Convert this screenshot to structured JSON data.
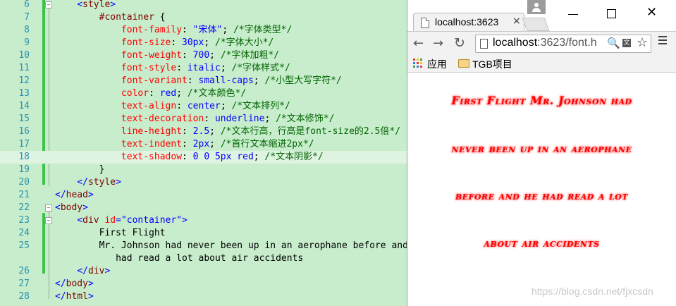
{
  "editor": {
    "lines": [
      {
        "n": "6",
        "indent": "    ",
        "tokens": [
          {
            "c": "t-punc",
            "t": "<"
          },
          {
            "c": "t-tag",
            "t": "style"
          },
          {
            "c": "t-punc",
            "t": ">"
          }
        ]
      },
      {
        "n": "7",
        "indent": "        ",
        "tokens": [
          {
            "c": "t-sel",
            "t": "#container"
          },
          {
            "c": "t-text",
            "t": " {"
          }
        ]
      },
      {
        "n": "8",
        "indent": "            ",
        "tokens": [
          {
            "c": "t-prop",
            "t": "font-family"
          },
          {
            "c": "t-text",
            "t": ": "
          },
          {
            "c": "t-val",
            "t": "\"宋体\""
          },
          {
            "c": "t-text",
            "t": "; "
          },
          {
            "c": "t-cmt",
            "t": "/*字体类型*/"
          }
        ]
      },
      {
        "n": "9",
        "indent": "            ",
        "tokens": [
          {
            "c": "t-prop",
            "t": "font-size"
          },
          {
            "c": "t-text",
            "t": ": "
          },
          {
            "c": "t-val",
            "t": "30px"
          },
          {
            "c": "t-text",
            "t": "; "
          },
          {
            "c": "t-cmt",
            "t": "/*字体大小*/"
          }
        ]
      },
      {
        "n": "10",
        "indent": "            ",
        "tokens": [
          {
            "c": "t-prop",
            "t": "font-weight"
          },
          {
            "c": "t-text",
            "t": ": "
          },
          {
            "c": "t-val",
            "t": "700"
          },
          {
            "c": "t-text",
            "t": "; "
          },
          {
            "c": "t-cmt",
            "t": "/*字体加粗*/"
          }
        ]
      },
      {
        "n": "11",
        "indent": "            ",
        "tokens": [
          {
            "c": "t-prop",
            "t": "font-style"
          },
          {
            "c": "t-text",
            "t": ": "
          },
          {
            "c": "t-val",
            "t": "italic"
          },
          {
            "c": "t-text",
            "t": "; "
          },
          {
            "c": "t-cmt",
            "t": "/*字体样式*/"
          }
        ]
      },
      {
        "n": "12",
        "indent": "            ",
        "tokens": [
          {
            "c": "t-prop",
            "t": "font-variant"
          },
          {
            "c": "t-text",
            "t": ": "
          },
          {
            "c": "t-val",
            "t": "small-caps"
          },
          {
            "c": "t-text",
            "t": "; "
          },
          {
            "c": "t-cmt",
            "t": "/*小型大写字符*/"
          }
        ]
      },
      {
        "n": "13",
        "indent": "            ",
        "tokens": [
          {
            "c": "t-prop",
            "t": "color"
          },
          {
            "c": "t-text",
            "t": ": "
          },
          {
            "c": "t-val",
            "t": "red"
          },
          {
            "c": "t-text",
            "t": "; "
          },
          {
            "c": "t-cmt",
            "t": "/*文本颜色*/"
          }
        ]
      },
      {
        "n": "14",
        "indent": "            ",
        "tokens": [
          {
            "c": "t-prop",
            "t": "text-align"
          },
          {
            "c": "t-text",
            "t": ": "
          },
          {
            "c": "t-val",
            "t": "center"
          },
          {
            "c": "t-text",
            "t": "; "
          },
          {
            "c": "t-cmt",
            "t": "/*文本排列*/"
          }
        ]
      },
      {
        "n": "15",
        "indent": "            ",
        "tokens": [
          {
            "c": "t-prop",
            "t": "text-decoration"
          },
          {
            "c": "t-text",
            "t": ": "
          },
          {
            "c": "t-val",
            "t": "underline"
          },
          {
            "c": "t-text",
            "t": "; "
          },
          {
            "c": "t-cmt",
            "t": "/*文本修饰*/"
          }
        ]
      },
      {
        "n": "16",
        "indent": "            ",
        "tokens": [
          {
            "c": "t-prop",
            "t": "line-height"
          },
          {
            "c": "t-text",
            "t": ": "
          },
          {
            "c": "t-val",
            "t": "2.5"
          },
          {
            "c": "t-text",
            "t": "; "
          },
          {
            "c": "t-cmt",
            "t": "/*文本行高，行高是font-size的2.5倍*/"
          }
        ]
      },
      {
        "n": "17",
        "indent": "            ",
        "tokens": [
          {
            "c": "t-prop",
            "t": "text-indent"
          },
          {
            "c": "t-text",
            "t": ": "
          },
          {
            "c": "t-val",
            "t": "2px"
          },
          {
            "c": "t-text",
            "t": "; "
          },
          {
            "c": "t-cmt",
            "t": "/*首行文本缩进2px*/"
          }
        ]
      },
      {
        "n": "18",
        "indent": "            ",
        "active": true,
        "tokens": [
          {
            "c": "t-prop",
            "t": "text-shadow"
          },
          {
            "c": "t-text",
            "t": ": "
          },
          {
            "c": "t-val",
            "t": "0 0 5px red"
          },
          {
            "c": "t-text",
            "t": "; "
          },
          {
            "c": "t-cmt",
            "t": "/*文本阴影*/"
          }
        ]
      },
      {
        "n": "19",
        "indent": "        ",
        "tokens": [
          {
            "c": "t-text",
            "t": "}"
          }
        ]
      },
      {
        "n": "20",
        "indent": "    ",
        "tokens": [
          {
            "c": "t-punc",
            "t": "</"
          },
          {
            "c": "t-tag",
            "t": "style"
          },
          {
            "c": "t-punc",
            "t": ">"
          }
        ]
      },
      {
        "n": "21",
        "indent": "",
        "tokens": [
          {
            "c": "t-punc",
            "t": "</"
          },
          {
            "c": "t-tag",
            "t": "head"
          },
          {
            "c": "t-punc",
            "t": ">"
          }
        ]
      },
      {
        "n": "22",
        "indent": "",
        "fold": true,
        "tokens": [
          {
            "c": "t-punc",
            "t": "<"
          },
          {
            "c": "t-tag",
            "t": "body"
          },
          {
            "c": "t-punc",
            "t": ">"
          }
        ]
      },
      {
        "n": "23",
        "indent": "    ",
        "fold": true,
        "tokens": [
          {
            "c": "t-punc",
            "t": "<"
          },
          {
            "c": "t-tag",
            "t": "div"
          },
          {
            "c": "t-text",
            "t": " "
          },
          {
            "c": "t-attr",
            "t": "id"
          },
          {
            "c": "t-punc",
            "t": "="
          },
          {
            "c": "t-str",
            "t": "\"container\""
          },
          {
            "c": "t-punc",
            "t": ">"
          }
        ]
      },
      {
        "n": "24",
        "indent": "        ",
        "tokens": [
          {
            "c": "t-text",
            "t": "First Flight"
          }
        ]
      },
      {
        "n": "25",
        "indent": "        ",
        "tokens": [
          {
            "c": "t-text",
            "t": "Mr. Johnson had never been up in an aerophane before and"
          }
        ]
      },
      {
        "n": "",
        "indent": "           ",
        "tokens": [
          {
            "c": "t-text",
            "t": "had read a lot about air accidents"
          }
        ]
      },
      {
        "n": "26",
        "indent": "    ",
        "tokens": [
          {
            "c": "t-punc",
            "t": "</"
          },
          {
            "c": "t-tag",
            "t": "div"
          },
          {
            "c": "t-punc",
            "t": ">"
          }
        ]
      },
      {
        "n": "27",
        "indent": "",
        "tokens": [
          {
            "c": "t-punc",
            "t": "</"
          },
          {
            "c": "t-tag",
            "t": "body"
          },
          {
            "c": "t-punc",
            "t": ">"
          }
        ]
      },
      {
        "n": "28",
        "indent": "",
        "tokens": [
          {
            "c": "t-punc",
            "t": "</"
          },
          {
            "c": "t-tag",
            "t": "html"
          },
          {
            "c": "t-punc",
            "t": ">"
          }
        ]
      }
    ]
  },
  "browser": {
    "tab_title": "localhost:3623",
    "tab_close": "×",
    "url_host": "localhost",
    "url_rest": ":3623/font.h",
    "back": "←",
    "forward": "→",
    "reload": "↻",
    "zoom": "🔍",
    "translate": "文",
    "star": "☆",
    "close": "✕",
    "bookmarks": {
      "apps": "应用",
      "folder": "TGB项目"
    },
    "demo_lines": [
      "First Flight Mr. Johnson had",
      "never been up in an aerophane",
      "before and he had read a lot",
      "about air accidents"
    ],
    "watermark": "https://blog.csdn.net/fjxcsdn"
  },
  "colors": {
    "editor_bg": "#c7edcc",
    "accent_red": "#ff0000",
    "line_numbers": "#2b91af"
  }
}
